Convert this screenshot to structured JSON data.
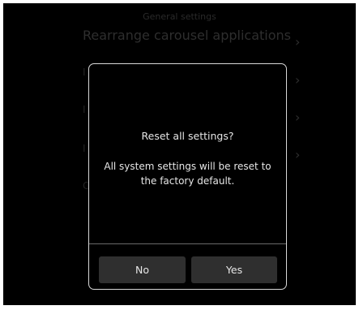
{
  "background": {
    "header_title": "General settings",
    "heading": "Rearrange carousel applications",
    "chevron": "›",
    "row_letters": [
      "I",
      "I",
      "I",
      "C"
    ]
  },
  "dialog": {
    "title": "Reset all settings?",
    "message": "All system settings will be reset to the factory default.",
    "no_label": "No",
    "yes_label": "Yes"
  }
}
